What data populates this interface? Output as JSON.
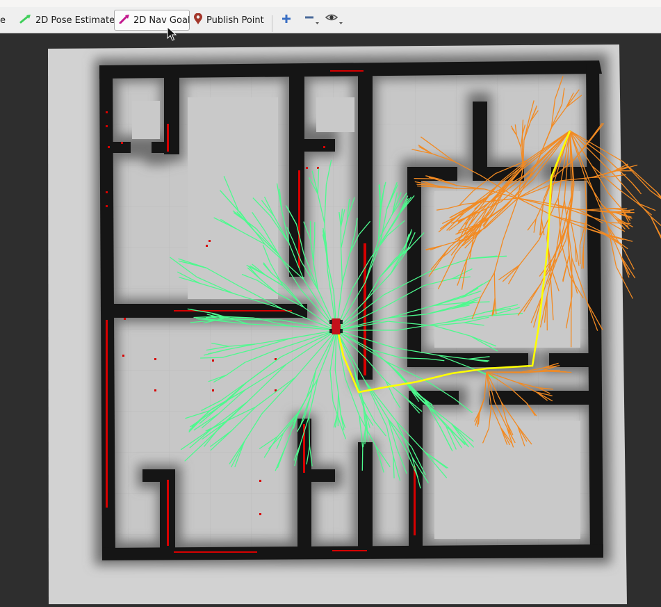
{
  "toolbar": {
    "cut_label": "e",
    "tools": [
      {
        "label": "2D Pose Estimate",
        "icon": "green-arrow-icon",
        "color": "#3fcf5a"
      },
      {
        "label": "2D Nav Goal",
        "icon": "magenta-arrow-icon",
        "color": "#c2188d",
        "active": true
      },
      {
        "label": "Publish Point",
        "icon": "map-pin-icon",
        "color": "#a3362a"
      }
    ],
    "icons": [
      "plus-icon",
      "minus-icon",
      "eye-icon"
    ]
  },
  "colors": {
    "map_free": "#c6c6c6",
    "map_unknown": "#d4d4d4",
    "walls": "#161616",
    "laser_points": "#d70000",
    "tree_a": "#4dfa8e",
    "tree_b": "#f28a22",
    "path": "#ffff00",
    "robot": "#c4121c"
  }
}
